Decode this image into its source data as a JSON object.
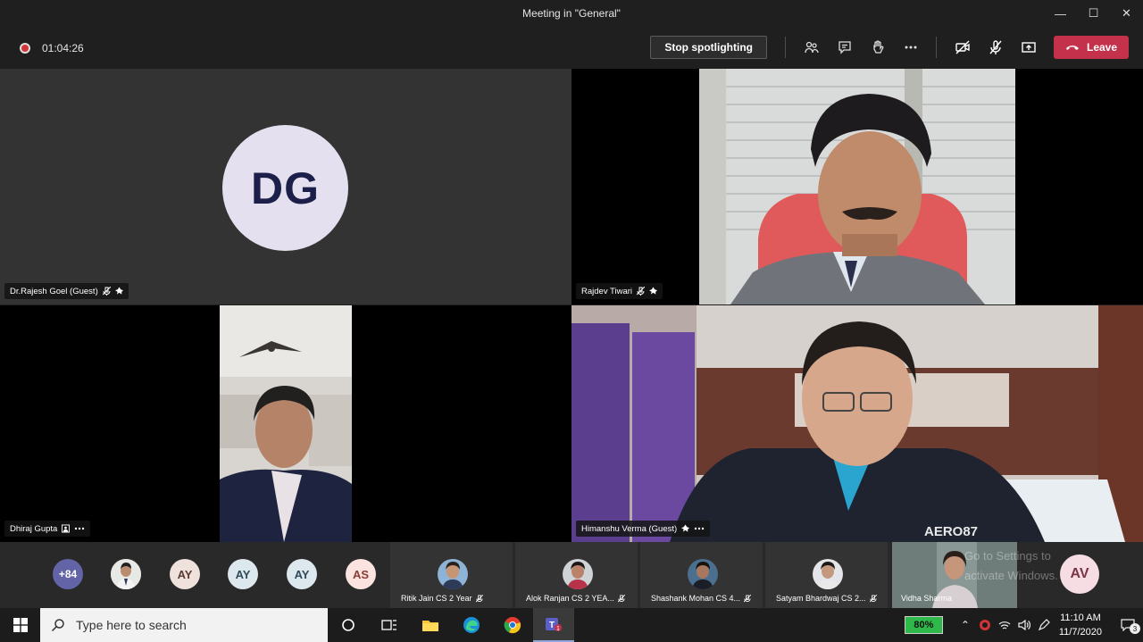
{
  "window": {
    "title": "Meeting in \"General\"",
    "minimize": "—",
    "maximize": "☐",
    "close": "✕"
  },
  "toolbar": {
    "recording_time": "01:04:26",
    "stop_spotlighting_label": "Stop spotlighting",
    "leave_label": "Leave",
    "icons": [
      "participants-icon",
      "chat-icon",
      "raise-hand-icon",
      "more-icon",
      "camera-off-icon",
      "mic-off-icon",
      "share-icon"
    ]
  },
  "tiles": [
    {
      "name": "Dr.Rajesh Goel (Guest)",
      "initials": "DG"
    },
    {
      "name": "Rajdev Tiwari"
    },
    {
      "name": "Dhiraj Gupta"
    },
    {
      "name": "Himanshu Verma (Guest)"
    }
  ],
  "strip": {
    "overflow_count": "+84",
    "avatars": [
      "AY",
      "AY",
      "AY",
      "AS"
    ],
    "participants": [
      {
        "name": "Ritik Jain CS 2 Year"
      },
      {
        "name": "Alok Ranjan CS 2 YEA..."
      },
      {
        "name": "Shashank Mohan CS 4..."
      },
      {
        "name": "Satyam Bhardwaj CS 2..."
      },
      {
        "name": "Vidha Sharma"
      }
    ],
    "self_initials": "AV",
    "watermark": "Go to Settings to activate Windows."
  },
  "taskbar": {
    "search_placeholder": "Type here to search",
    "battery": "80%",
    "time": "11:10 AM",
    "date": "11/7/2020",
    "notifications": "3"
  },
  "colors": {
    "leave": "#c4314b",
    "accent": "#6264a7",
    "avatar_bg": "#e4e0ef"
  }
}
